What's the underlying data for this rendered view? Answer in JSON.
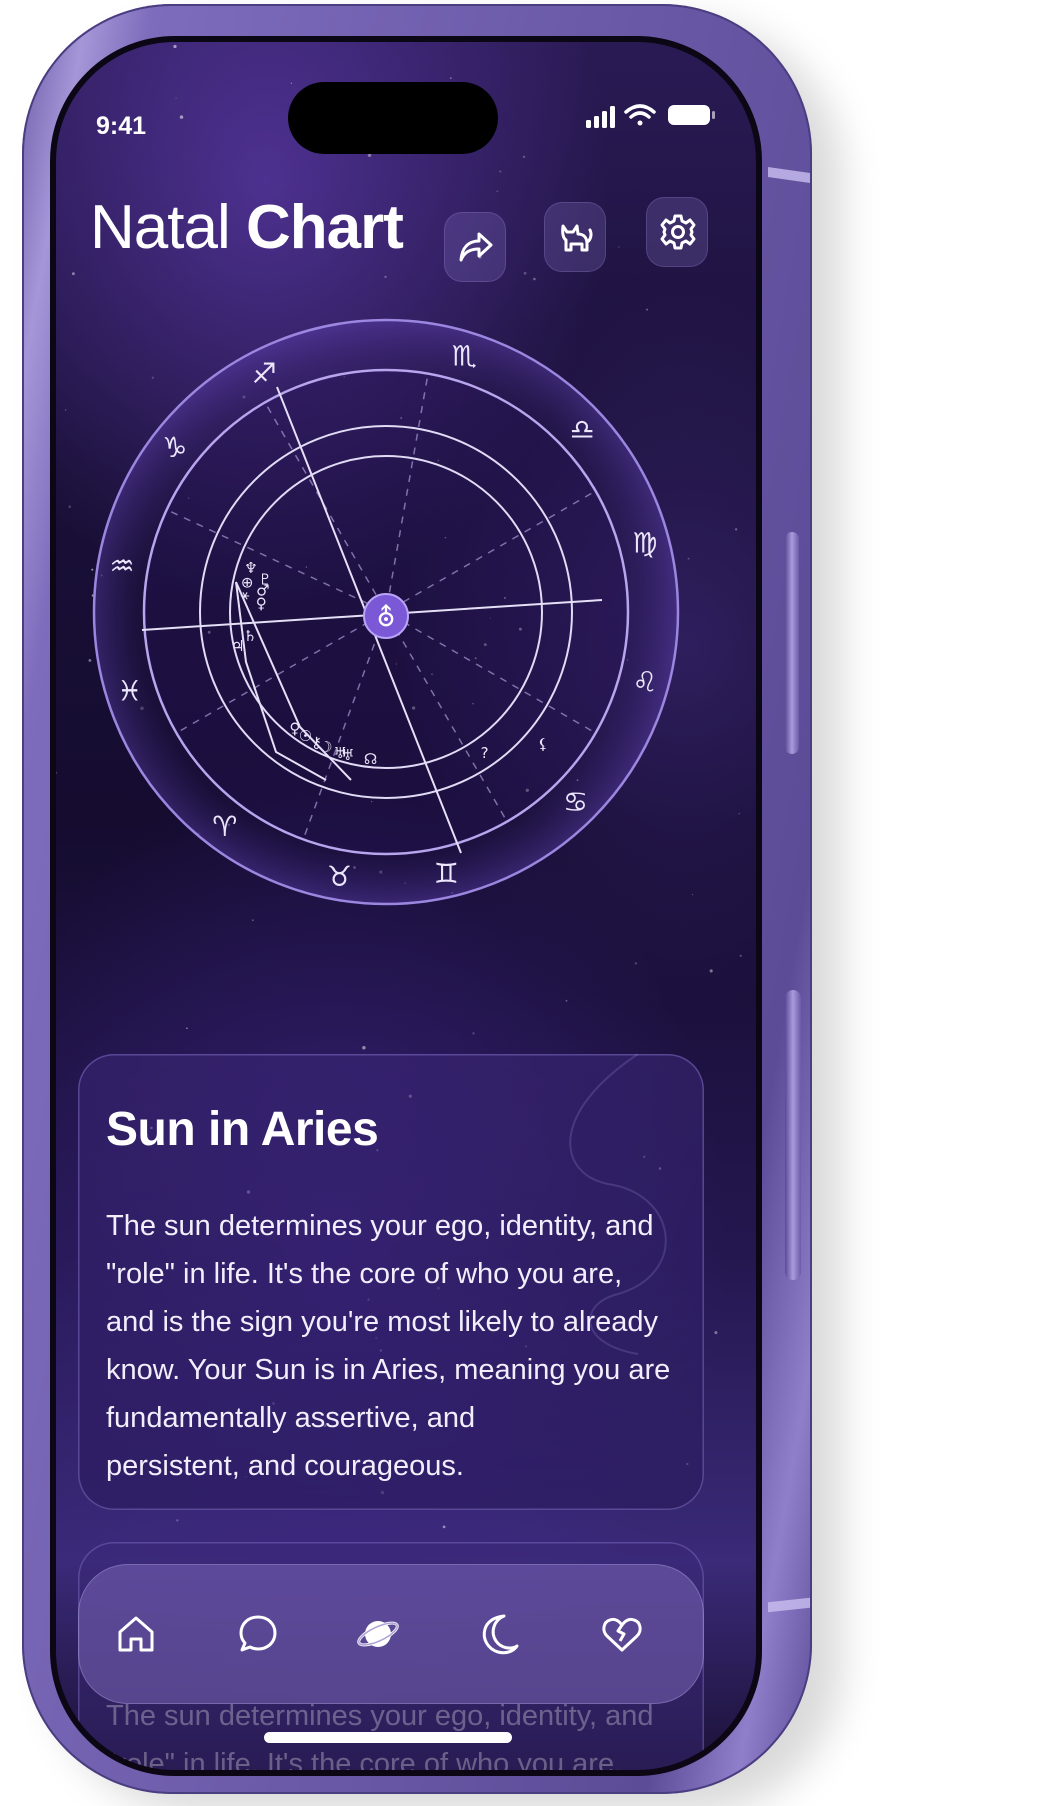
{
  "status_bar": {
    "time": "9:41"
  },
  "header": {
    "title_light": "Natal",
    "title_bold": "Chart",
    "actions": [
      {
        "name": "share-button",
        "icon": "share-icon"
      },
      {
        "name": "pet-button",
        "icon": "cat-icon"
      },
      {
        "name": "settings-button",
        "icon": "gear-icon"
      }
    ]
  },
  "chart": {
    "center_symbol": "⛢",
    "zodiac": [
      "♏",
      "♎",
      "♍",
      "♌",
      "♋",
      "♊",
      "♉",
      "♈",
      "♓",
      "♒",
      "♑",
      "♐"
    ],
    "planets_cluster_left": [
      "♆",
      "♇",
      "⊕",
      "♂",
      "⚹",
      "♀",
      "♄",
      "♃"
    ],
    "planets_cluster_bottom": [
      "♀",
      "☉",
      "⚷",
      "☽",
      "♅",
      "♅",
      "☊"
    ],
    "planets_right": [
      "⚸",
      "?"
    ],
    "colors": {
      "accent": "#7a58d6",
      "line": "#d9d0f2",
      "ring": "#9b86e0"
    }
  },
  "card": {
    "title": "Sun in Aries",
    "body_lines": [
      "The sun determines your ego, identity, and",
      "\"role\" in life. It's the core of who you are,",
      "and is the sign you're most likely to already",
      "know. Your Sun is in Aries, meaning you are",
      "fundamentally  assertive, and",
      "persistent, and courageous."
    ]
  },
  "card_ghost": {
    "lines": [
      "The sun determines your ego, identity, and",
      "\"role\" in life. It's the core of who you are,"
    ]
  },
  "tabbar": {
    "items": [
      {
        "name": "home",
        "icon": "home-icon"
      },
      {
        "name": "chat",
        "icon": "chat-bubble-icon"
      },
      {
        "name": "chart",
        "icon": "planet-icon"
      },
      {
        "name": "moon",
        "icon": "moon-icon"
      },
      {
        "name": "heart",
        "icon": "puzzle-heart-icon"
      }
    ]
  }
}
